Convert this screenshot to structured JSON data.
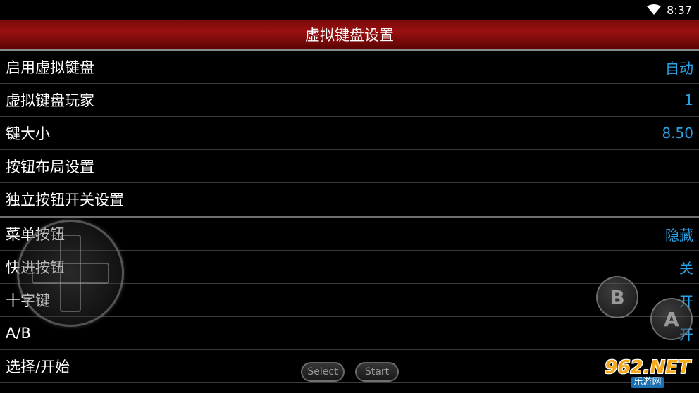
{
  "status_bar": {
    "time": "8:37",
    "wifi_icon": "wifi-icon"
  },
  "header": {
    "title": "虚拟键盘设置"
  },
  "settings": [
    {
      "label": "启用虚拟键盘",
      "value": "自动"
    },
    {
      "label": "虚拟键盘玩家",
      "value": "1"
    },
    {
      "label": "键大小",
      "value": "8.50"
    },
    {
      "label": "按钮布局设置",
      "value": ""
    },
    {
      "label": "独立按钮开关设置",
      "value": ""
    },
    {
      "label": "菜单按钮",
      "value": "隐藏"
    },
    {
      "label": "快进按钮",
      "value": "关"
    },
    {
      "label": "十字键",
      "value": "开"
    },
    {
      "label": "A/B",
      "value": "开"
    },
    {
      "label": "选择/开始",
      "value": ""
    }
  ],
  "gamepad": {
    "b_label": "B",
    "a_label": "A",
    "select_label": "Select",
    "start_label": "Start"
  },
  "watermark": {
    "main": "962.NET",
    "sub": "乐游网"
  },
  "colors": {
    "header_red": "#9a1010",
    "value_blue": "#29a3e8",
    "background": "#000000"
  }
}
